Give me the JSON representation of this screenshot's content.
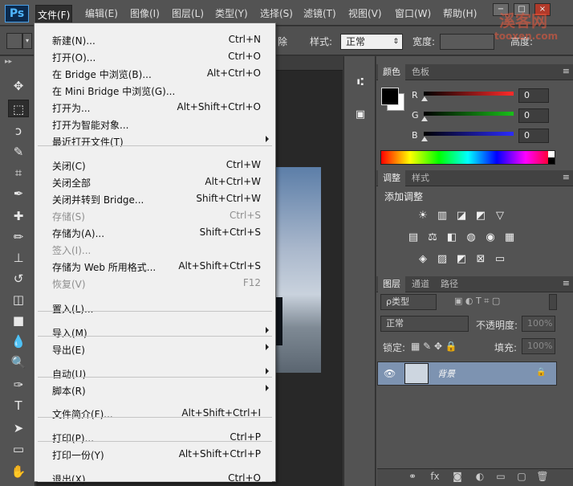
{
  "app": {
    "logo": "Ps"
  },
  "menubar": {
    "items": [
      "文件(F)",
      "编辑(E)",
      "图像(I)",
      "图层(L)",
      "类型(Y)",
      "选择(S)",
      "滤镜(T)",
      "视图(V)",
      "窗口(W)",
      "帮助(H)"
    ],
    "active": 0,
    "window_buttons": [
      "−",
      "□",
      "×"
    ]
  },
  "options_bar": {
    "style_label": "样式:",
    "style_value": "正常",
    "width_label": "宽度:",
    "height_label": "高度:",
    "truncated_text": "除"
  },
  "watermark": {
    "line1": "溪客网",
    "line2": "tooxen.com"
  },
  "file_menu": {
    "items": [
      {
        "label": "新建(N)...",
        "shortcut": "Ctrl+N",
        "disabled": false,
        "submenu": false
      },
      {
        "label": "打开(O)...",
        "shortcut": "Ctrl+O",
        "disabled": false,
        "submenu": false
      },
      {
        "label": "在 Bridge 中浏览(B)...",
        "shortcut": "Alt+Ctrl+O",
        "disabled": false,
        "submenu": false
      },
      {
        "label": "在 Mini Bridge 中浏览(G)...",
        "shortcut": "",
        "disabled": false,
        "submenu": false
      },
      {
        "label": "打开为...",
        "shortcut": "Alt+Shift+Ctrl+O",
        "disabled": false,
        "submenu": false
      },
      {
        "label": "打开为智能对象...",
        "shortcut": "",
        "disabled": false,
        "submenu": false
      },
      {
        "label": "最近打开文件(T)",
        "shortcut": "",
        "disabled": false,
        "submenu": true
      },
      {
        "label": "关闭(C)",
        "shortcut": "Ctrl+W",
        "disabled": false,
        "submenu": false
      },
      {
        "label": "关闭全部",
        "shortcut": "Alt+Ctrl+W",
        "disabled": false,
        "submenu": false
      },
      {
        "label": "关闭并转到 Bridge...",
        "shortcut": "Shift+Ctrl+W",
        "disabled": false,
        "submenu": false
      },
      {
        "label": "存储(S)",
        "shortcut": "Ctrl+S",
        "disabled": true,
        "submenu": false
      },
      {
        "label": "存储为(A)...",
        "shortcut": "Shift+Ctrl+S",
        "disabled": false,
        "submenu": false
      },
      {
        "label": "签入(I)...",
        "shortcut": "",
        "disabled": true,
        "submenu": false
      },
      {
        "label": "存储为 Web 所用格式...",
        "shortcut": "Alt+Shift+Ctrl+S",
        "disabled": false,
        "submenu": false
      },
      {
        "label": "恢复(V)",
        "shortcut": "F12",
        "disabled": true,
        "submenu": false
      },
      {
        "label": "置入(L)...",
        "shortcut": "",
        "disabled": false,
        "submenu": false
      },
      {
        "label": "导入(M)",
        "shortcut": "",
        "disabled": false,
        "submenu": true
      },
      {
        "label": "导出(E)",
        "shortcut": "",
        "disabled": false,
        "submenu": true
      },
      {
        "label": "自动(U)",
        "shortcut": "",
        "disabled": false,
        "submenu": true
      },
      {
        "label": "脚本(R)",
        "shortcut": "",
        "disabled": false,
        "submenu": true
      },
      {
        "label": "文件简介(F)...",
        "shortcut": "Alt+Shift+Ctrl+I",
        "disabled": false,
        "submenu": false
      },
      {
        "label": "打印(P)...",
        "shortcut": "Ctrl+P",
        "disabled": false,
        "submenu": false
      },
      {
        "label": "打印一份(Y)",
        "shortcut": "Alt+Shift+Ctrl+P",
        "disabled": false,
        "submenu": false
      },
      {
        "label": "退出(X)",
        "shortcut": "Ctrl+Q",
        "disabled": false,
        "submenu": false
      }
    ]
  },
  "color_panel": {
    "tabs": [
      "颜色",
      "色板"
    ],
    "channels": [
      {
        "label": "R",
        "value": "0",
        "color": "#ff2a2a"
      },
      {
        "label": "G",
        "value": "0",
        "color": "#19c019"
      },
      {
        "label": "B",
        "value": "0",
        "color": "#2b2bff"
      }
    ]
  },
  "adjustments_panel": {
    "tabs": [
      "调整",
      "样式"
    ],
    "title": "添加调整"
  },
  "layers_panel": {
    "tabs": [
      "图层",
      "通道",
      "路径"
    ],
    "kind_filter": "ρ类型",
    "blend_mode": "正常",
    "opacity_label": "不透明度:",
    "opacity_value": "100%",
    "lock_label": "锁定:",
    "fill_label": "填充:",
    "fill_value": "100%",
    "layer_name": "背景"
  },
  "tools": {
    "icons": [
      "move-icon",
      "marquee-icon",
      "lasso-icon",
      "quick-select-icon",
      "crop-icon",
      "eyedropper-icon",
      "healing-icon",
      "brush-icon",
      "stamp-icon",
      "history-brush-icon",
      "eraser-icon",
      "gradient-icon",
      "blur-icon",
      "dodge-icon",
      "pen-icon",
      "type-icon",
      "path-select-icon",
      "shape-icon",
      "hand-icon"
    ]
  },
  "colors": {
    "menubar_bg": "#535353",
    "menu_bg": "#f0f0f0",
    "layer_selected": "#7d93b1"
  }
}
